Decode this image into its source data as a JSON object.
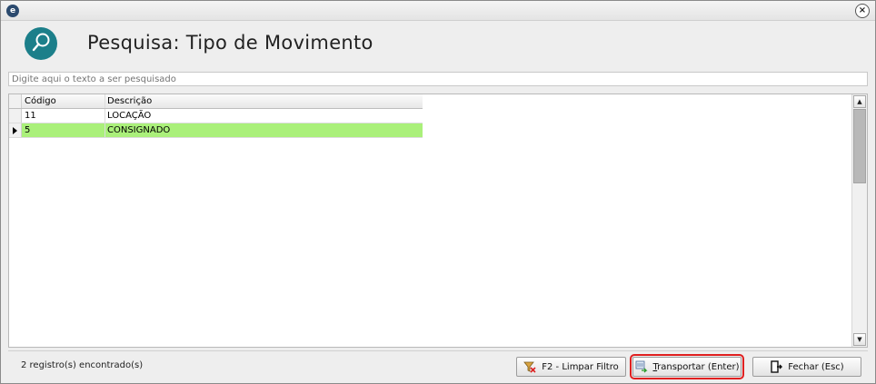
{
  "window": {
    "app_icon_letter": "e",
    "close_glyph": "×"
  },
  "header": {
    "title": "Pesquisa: Tipo de Movimento",
    "icon": "search-icon"
  },
  "search": {
    "placeholder": "Digite aqui o texto a ser pesquisado",
    "value": ""
  },
  "grid": {
    "columns": [
      "Código",
      "Descrição"
    ],
    "rows": [
      {
        "code": "11",
        "description": "LOCAÇÃO",
        "selected": false
      },
      {
        "code": "5",
        "description": "CONSIGNADO",
        "selected": true
      }
    ],
    "selected_color": "#aaf07a"
  },
  "scrollbar": {
    "up_glyph": "▲",
    "down_glyph": "▼"
  },
  "status": {
    "count_text": "2 registro(s) encontrado(s)"
  },
  "buttons": {
    "clear_filter": "F2 - Limpar Filtro",
    "transport": "Transportar (Enter)",
    "close": "Fechar (Esc)"
  },
  "colors": {
    "accent": "#1c7f8a",
    "highlight_border": "#e02020"
  }
}
